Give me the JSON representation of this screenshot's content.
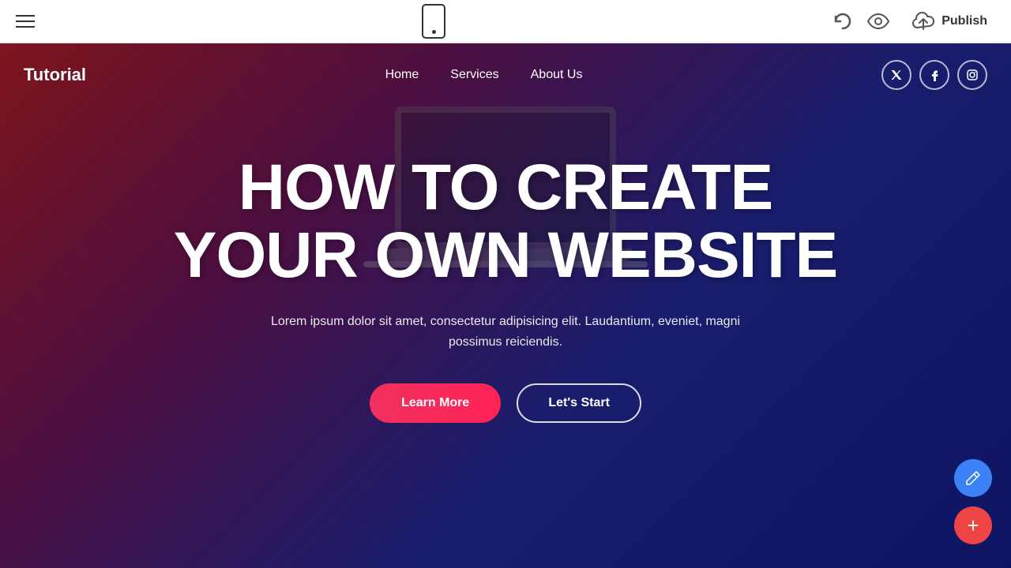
{
  "toolbar": {
    "publish_label": "Publish",
    "hamburger_name": "hamburger-menu",
    "mobile_preview_name": "mobile-preview-icon",
    "undo_name": "undo-icon",
    "eye_name": "preview-icon",
    "cloud_name": "cloud-icon"
  },
  "site": {
    "logo": "Tutorial",
    "nav": {
      "links": [
        {
          "label": "Home",
          "key": "home"
        },
        {
          "label": "Services",
          "key": "services"
        },
        {
          "label": "About Us",
          "key": "about-us"
        }
      ]
    },
    "social": [
      {
        "label": "T",
        "name": "twitter-icon",
        "symbol": "𝕏"
      },
      {
        "label": "f",
        "name": "facebook-icon",
        "symbol": "f"
      },
      {
        "label": "I",
        "name": "instagram-icon",
        "symbol": "◫"
      }
    ]
  },
  "hero": {
    "title_line1": "HOW TO CREATE",
    "title_line2": "YOUR OWN WEBSITE",
    "subtitle": "Lorem ipsum dolor sit amet, consectetur adipisicing elit. Laudantium, eveniet, magni possimus reiciendis.",
    "btn_learn_more": "Learn More",
    "btn_lets_start": "Let's Start"
  },
  "fab": {
    "edit_label": "✏",
    "add_label": "+"
  }
}
